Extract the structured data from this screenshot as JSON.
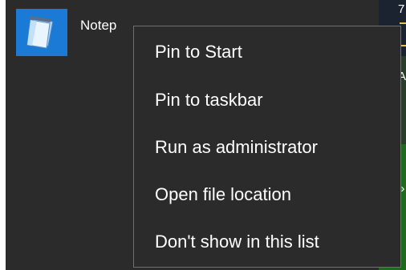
{
  "app": {
    "name": "Notep",
    "icon": "notepad-icon",
    "tile_color": "#1a7ad6"
  },
  "desktop_edge": {
    "glyphs": [
      "7",
      "A",
      "»"
    ]
  },
  "context_menu": {
    "items": [
      {
        "label": "Pin to Start"
      },
      {
        "label": "Pin to taskbar"
      },
      {
        "label": "Run as administrator"
      },
      {
        "label": "Open file location"
      },
      {
        "label": "Don't show in this list"
      }
    ]
  },
  "colors": {
    "menu_background": "#2b2b2b",
    "menu_border": "#707070",
    "text": "#ffffff"
  }
}
